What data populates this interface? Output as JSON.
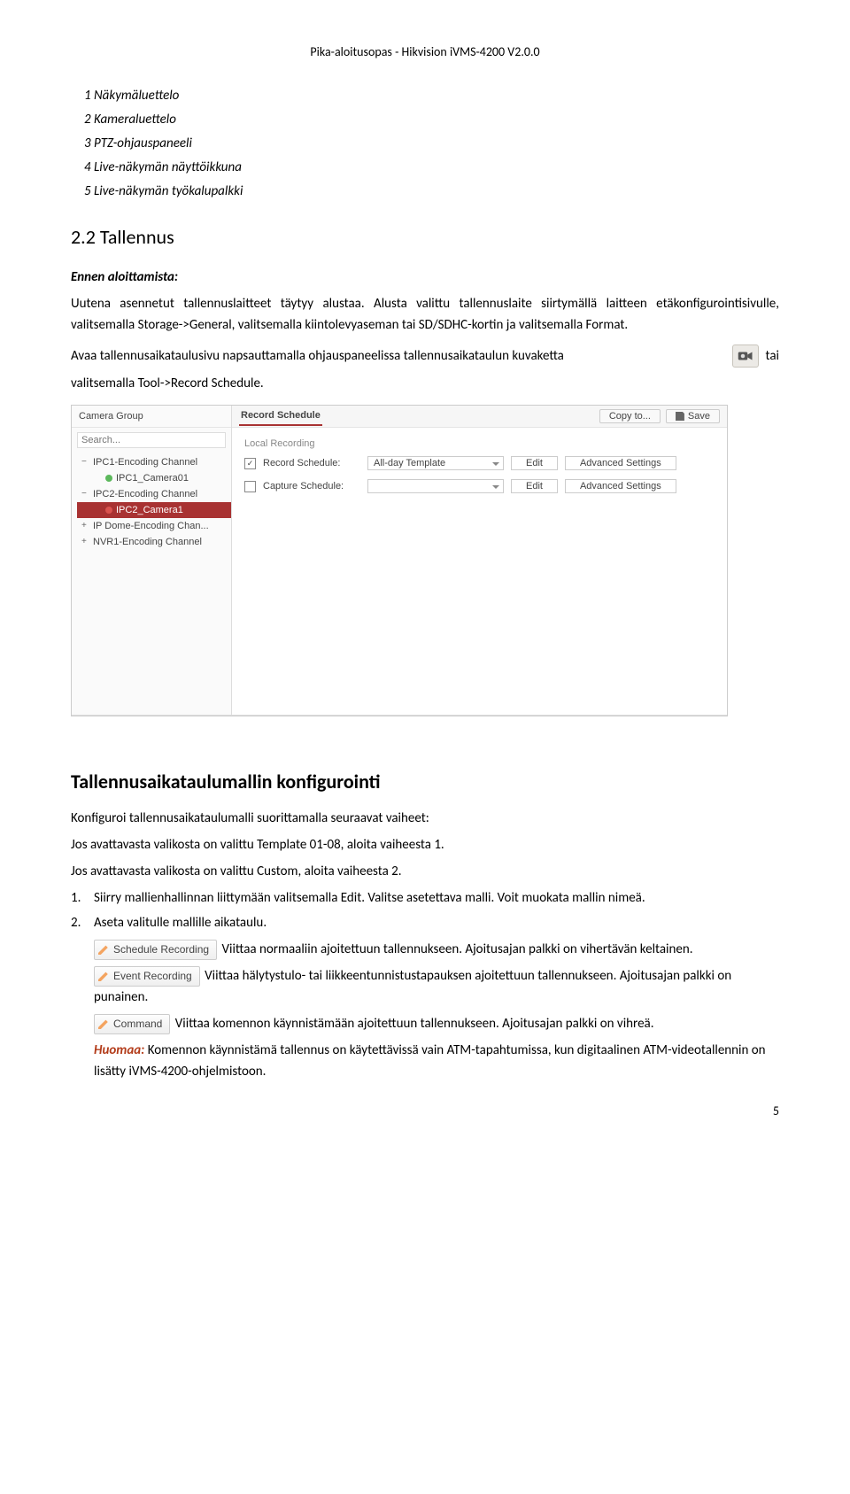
{
  "header": "Pika-aloitusopas - Hikvision iVMS-4200 V2.0.0",
  "legend": {
    "1": "1 Näkymäluettelo",
    "2": "2 Kameraluettelo",
    "3": "3 PTZ-ohjauspaneeli",
    "4": "4 Live-näkymän näyttöikkuna",
    "5": "5 Live-näkymän työkalupalkki"
  },
  "section_title": "2.2 Tallennus",
  "ennen_label": "Ennen aloittamista:",
  "para1": "Uutena asennetut tallennuslaitteet täytyy alustaa. Alusta valittu tallennuslaite siirtymällä laitteen etäkonfigurointisivulle, valitsemalla Storage->General, valitsemalla kiintolevyaseman tai SD/SDHC-kortin ja valitsemalla Format.",
  "para2_pre": "Avaa tallennusaikataulusivu napsauttamalla ohjauspaneelissa tallennusaikataulun kuvaketta",
  "para2_post": "tai",
  "para3": "valitsemalla  Tool->Record Schedule.",
  "screenshot": {
    "sidebar_title": "Camera Group",
    "search_placeholder": "Search...",
    "tree": {
      "g1": "IPC1-Encoding Channel",
      "g1c1": "IPC1_Camera01",
      "g2": "IPC2-Encoding Channel",
      "g2c1": "IPC2_Camera1",
      "g3": "IP Dome-Encoding Chan...",
      "g4": "NVR1-Encoding Channel"
    },
    "tab": "Record Schedule",
    "copy_btn": "Copy to...",
    "save_btn": "Save",
    "section_label": "Local Recording",
    "row1_label": "Record Schedule:",
    "row1_select": "All-day Template",
    "edit": "Edit",
    "adv": "Advanced Settings",
    "row2_label": "Capture Schedule:"
  },
  "config_heading": "Tallennusaikataulumallin konfigurointi",
  "config_p1": "Konfiguroi tallennusaikataulumalli suorittamalla seuraavat vaiheet:",
  "config_p2": "Jos avattavasta valikosta on valittu Template 01-08, aloita vaiheesta 1.",
  "config_p3": "Jos avattavasta valikosta on valittu Custom, aloita vaiheesta 2.",
  "step1": "Siirry mallienhallinnan liittymään valitsemalla Edit. Valitse asetettava malli. Voit muokata mallin nimeä.",
  "step2": "Aseta valitulle mallille aikataulu.",
  "tags": {
    "schedule": "Schedule Recording",
    "event": "Event Recording",
    "command": "Command"
  },
  "tag_text": {
    "schedule": "Viittaa normaaliin ajoitettuun tallennukseen. Ajoitusajan palkki on vihertävän keltainen.",
    "event": "Viittaa hälytystulo- tai liikkeentunnistustapauksen ajoitettuun tallennukseen. Ajoitusajan palkki on punainen.",
    "command": "Viittaa komennon käynnistämään ajoitettuun tallennukseen. Ajoitusajan palkki on vihreä."
  },
  "huomaa_label": "Huomaa:",
  "huomaa_text": "Komennon käynnistämä tallennus on käytettävissä vain ATM-tapahtumissa, kun digitaalinen ATM-videotallennin on lisätty iVMS-4200-ohjelmistoon.",
  "pagenum": "5"
}
